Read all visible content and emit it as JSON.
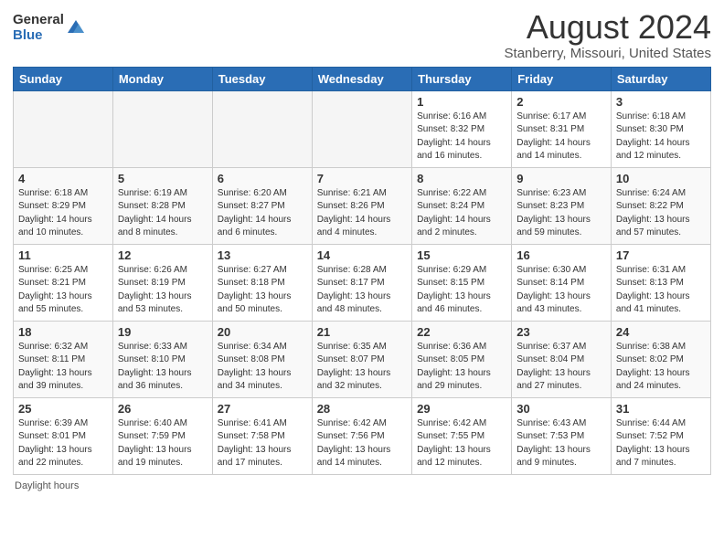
{
  "logo": {
    "general": "General",
    "blue": "Blue"
  },
  "title": "August 2024",
  "subtitle": "Stanberry, Missouri, United States",
  "days_of_week": [
    "Sunday",
    "Monday",
    "Tuesday",
    "Wednesday",
    "Thursday",
    "Friday",
    "Saturday"
  ],
  "weeks": [
    [
      {
        "day": "",
        "detail": ""
      },
      {
        "day": "",
        "detail": ""
      },
      {
        "day": "",
        "detail": ""
      },
      {
        "day": "",
        "detail": ""
      },
      {
        "day": "1",
        "detail": "Sunrise: 6:16 AM\nSunset: 8:32 PM\nDaylight: 14 hours\nand 16 minutes."
      },
      {
        "day": "2",
        "detail": "Sunrise: 6:17 AM\nSunset: 8:31 PM\nDaylight: 14 hours\nand 14 minutes."
      },
      {
        "day": "3",
        "detail": "Sunrise: 6:18 AM\nSunset: 8:30 PM\nDaylight: 14 hours\nand 12 minutes."
      }
    ],
    [
      {
        "day": "4",
        "detail": "Sunrise: 6:18 AM\nSunset: 8:29 PM\nDaylight: 14 hours\nand 10 minutes."
      },
      {
        "day": "5",
        "detail": "Sunrise: 6:19 AM\nSunset: 8:28 PM\nDaylight: 14 hours\nand 8 minutes."
      },
      {
        "day": "6",
        "detail": "Sunrise: 6:20 AM\nSunset: 8:27 PM\nDaylight: 14 hours\nand 6 minutes."
      },
      {
        "day": "7",
        "detail": "Sunrise: 6:21 AM\nSunset: 8:26 PM\nDaylight: 14 hours\nand 4 minutes."
      },
      {
        "day": "8",
        "detail": "Sunrise: 6:22 AM\nSunset: 8:24 PM\nDaylight: 14 hours\nand 2 minutes."
      },
      {
        "day": "9",
        "detail": "Sunrise: 6:23 AM\nSunset: 8:23 PM\nDaylight: 13 hours\nand 59 minutes."
      },
      {
        "day": "10",
        "detail": "Sunrise: 6:24 AM\nSunset: 8:22 PM\nDaylight: 13 hours\nand 57 minutes."
      }
    ],
    [
      {
        "day": "11",
        "detail": "Sunrise: 6:25 AM\nSunset: 8:21 PM\nDaylight: 13 hours\nand 55 minutes."
      },
      {
        "day": "12",
        "detail": "Sunrise: 6:26 AM\nSunset: 8:19 PM\nDaylight: 13 hours\nand 53 minutes."
      },
      {
        "day": "13",
        "detail": "Sunrise: 6:27 AM\nSunset: 8:18 PM\nDaylight: 13 hours\nand 50 minutes."
      },
      {
        "day": "14",
        "detail": "Sunrise: 6:28 AM\nSunset: 8:17 PM\nDaylight: 13 hours\nand 48 minutes."
      },
      {
        "day": "15",
        "detail": "Sunrise: 6:29 AM\nSunset: 8:15 PM\nDaylight: 13 hours\nand 46 minutes."
      },
      {
        "day": "16",
        "detail": "Sunrise: 6:30 AM\nSunset: 8:14 PM\nDaylight: 13 hours\nand 43 minutes."
      },
      {
        "day": "17",
        "detail": "Sunrise: 6:31 AM\nSunset: 8:13 PM\nDaylight: 13 hours\nand 41 minutes."
      }
    ],
    [
      {
        "day": "18",
        "detail": "Sunrise: 6:32 AM\nSunset: 8:11 PM\nDaylight: 13 hours\nand 39 minutes."
      },
      {
        "day": "19",
        "detail": "Sunrise: 6:33 AM\nSunset: 8:10 PM\nDaylight: 13 hours\nand 36 minutes."
      },
      {
        "day": "20",
        "detail": "Sunrise: 6:34 AM\nSunset: 8:08 PM\nDaylight: 13 hours\nand 34 minutes."
      },
      {
        "day": "21",
        "detail": "Sunrise: 6:35 AM\nSunset: 8:07 PM\nDaylight: 13 hours\nand 32 minutes."
      },
      {
        "day": "22",
        "detail": "Sunrise: 6:36 AM\nSunset: 8:05 PM\nDaylight: 13 hours\nand 29 minutes."
      },
      {
        "day": "23",
        "detail": "Sunrise: 6:37 AM\nSunset: 8:04 PM\nDaylight: 13 hours\nand 27 minutes."
      },
      {
        "day": "24",
        "detail": "Sunrise: 6:38 AM\nSunset: 8:02 PM\nDaylight: 13 hours\nand 24 minutes."
      }
    ],
    [
      {
        "day": "25",
        "detail": "Sunrise: 6:39 AM\nSunset: 8:01 PM\nDaylight: 13 hours\nand 22 minutes."
      },
      {
        "day": "26",
        "detail": "Sunrise: 6:40 AM\nSunset: 7:59 PM\nDaylight: 13 hours\nand 19 minutes."
      },
      {
        "day": "27",
        "detail": "Sunrise: 6:41 AM\nSunset: 7:58 PM\nDaylight: 13 hours\nand 17 minutes."
      },
      {
        "day": "28",
        "detail": "Sunrise: 6:42 AM\nSunset: 7:56 PM\nDaylight: 13 hours\nand 14 minutes."
      },
      {
        "day": "29",
        "detail": "Sunrise: 6:42 AM\nSunset: 7:55 PM\nDaylight: 13 hours\nand 12 minutes."
      },
      {
        "day": "30",
        "detail": "Sunrise: 6:43 AM\nSunset: 7:53 PM\nDaylight: 13 hours\nand 9 minutes."
      },
      {
        "day": "31",
        "detail": "Sunrise: 6:44 AM\nSunset: 7:52 PM\nDaylight: 13 hours\nand 7 minutes."
      }
    ]
  ],
  "footer_note": "Daylight hours"
}
